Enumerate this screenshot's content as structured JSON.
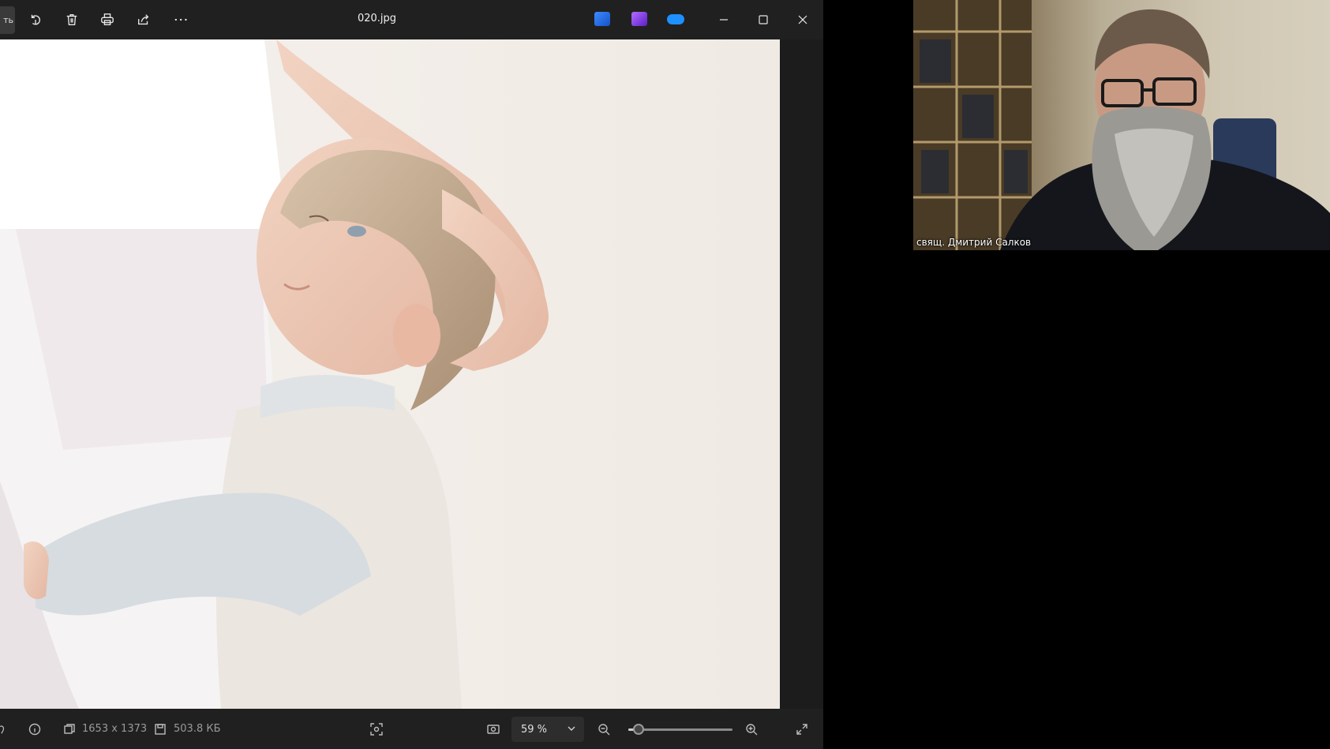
{
  "viewer": {
    "edit_label": "ть",
    "file_name": "020.jpg",
    "toolbar": {
      "rotate_icon": "rotate-icon",
      "delete_icon": "trash-icon",
      "print_icon": "printer-icon",
      "share_icon": "share-icon",
      "more_icon": "more-icon"
    },
    "apps": [
      {
        "name": "edit-app-icon",
        "color": "#2f6fd6"
      },
      {
        "name": "clipchamp-icon",
        "color": "#7b3fe0"
      },
      {
        "name": "onedrive-icon",
        "color": "#1e90ff"
      }
    ],
    "status": {
      "dimensions": "1653 x 1373",
      "file_size": "503.8 КБ",
      "zoom_value": "59 %",
      "zoom_level": 0.1
    }
  },
  "video": {
    "participant_name": "свящ. Дмитрий Салков"
  }
}
